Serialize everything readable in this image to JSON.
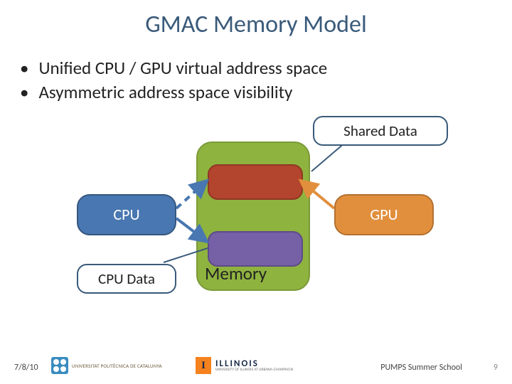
{
  "title": "GMAC Memory Model",
  "bullets": [
    "Unified CPU / GPU virtual address space",
    "Asymmetric address space visibility"
  ],
  "diagram": {
    "cpu_label": "CPU",
    "gpu_label": "GPU",
    "memory_label": "Memory",
    "shared_data_label": "Shared Data",
    "cpu_data_label": "CPU Data"
  },
  "colors": {
    "title": "#3a5a7a",
    "cpu": "#4877b1",
    "gpu": "#e18f3d",
    "memory_block": "#8fb33f",
    "inner_top": "#b3442d",
    "inner_bottom": "#7660a6"
  },
  "footer": {
    "date": "7/8/10",
    "conference": "PUMPS Summer School",
    "page_number": "9",
    "logo_upc_text": "UNIVERSITAT POLITÈCNICA\nDE CATALUNYA",
    "logo_illinois_big": "ILLINOIS",
    "logo_illinois_small": "UNIVERSITY OF ILLINOIS AT URBANA-CHAMPAIGN"
  }
}
